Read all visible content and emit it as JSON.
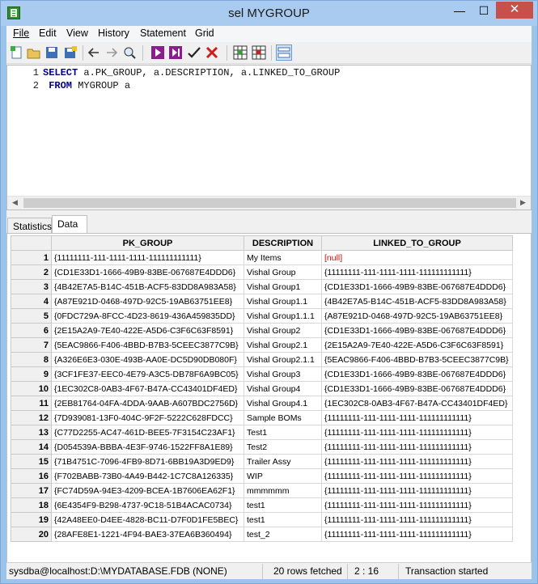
{
  "window": {
    "title": "sel MYGROUP"
  },
  "menu": [
    "File",
    "Edit",
    "View",
    "History",
    "Statement",
    "Grid"
  ],
  "toolbar_icons": [
    "new-icon",
    "open-icon",
    "save-icon",
    "save-as-icon",
    "back-icon",
    "forward-icon",
    "find-icon",
    "execute-icon",
    "execute-step-icon",
    "commit-icon",
    "rollback-icon",
    "grid-view-icon",
    "grid-close-icon",
    "split-view-icon"
  ],
  "editor": {
    "lines": [
      {
        "num": "1",
        "parts": [
          [
            "kw",
            "SELECT"
          ],
          [
            "t",
            " a.PK_GROUP, a.DESCRIPTION, a.LINKED_TO_GROUP"
          ]
        ]
      },
      {
        "num": "2",
        "parts": [
          [
            "t",
            " "
          ],
          [
            "kw",
            "FROM"
          ],
          [
            "t",
            " MYGROUP a"
          ]
        ]
      }
    ]
  },
  "tabs": [
    {
      "label": "Statistics",
      "active": false
    },
    {
      "label": "Data",
      "active": true
    }
  ],
  "grid": {
    "columns": [
      "PK_GROUP",
      "DESCRIPTION",
      "LINKED_TO_GROUP"
    ],
    "rows": [
      [
        "1",
        "{11111111-111-1111-1111-111111111111}",
        "My Items",
        "[null]"
      ],
      [
        "2",
        "{CD1E33D1-1666-49B9-83BE-067687E4DDD6}",
        "Vishal Group",
        "{11111111-111-1111-1111-111111111111}"
      ],
      [
        "3",
        "{4B42E7A5-B14C-451B-ACF5-83DD8A983A58}",
        "Vishal Group1",
        "{CD1E33D1-1666-49B9-83BE-067687E4DDD6}"
      ],
      [
        "4",
        "{A87E921D-0468-497D-92C5-19AB63751EE8}",
        "Vishal Group1.1",
        "{4B42E7A5-B14C-451B-ACF5-83DD8A983A58}"
      ],
      [
        "5",
        "{0FDC729A-8FCC-4D23-8619-436A459835DD}",
        "Vishal Group1.1.1",
        "{A87E921D-0468-497D-92C5-19AB63751EE8}"
      ],
      [
        "6",
        "{2E15A2A9-7E40-422E-A5D6-C3F6C63F8591}",
        "Vishal Group2",
        "{CD1E33D1-1666-49B9-83BE-067687E4DDD6}"
      ],
      [
        "7",
        "{5EAC9866-F406-4BBD-B7B3-5CEEC3877C9B}",
        "Vishal Group2.1",
        "{2E15A2A9-7E40-422E-A5D6-C3F6C63F8591}"
      ],
      [
        "8",
        "{A326E6E3-030E-493B-AA0E-DC5D90DB080F}",
        "Vishal Group2.1.1",
        "{5EAC9866-F406-4BBD-B7B3-5CEEC3877C9B}"
      ],
      [
        "9",
        "{3CF1FE37-EEC0-4E79-A3C5-DB78F6A9BC05}",
        "Vishal Group3",
        "{CD1E33D1-1666-49B9-83BE-067687E4DDD6}"
      ],
      [
        "10",
        "{1EC302C8-0AB3-4F67-B47A-CC43401DF4ED}",
        "Vishal Group4",
        "{CD1E33D1-1666-49B9-83BE-067687E4DDD6}"
      ],
      [
        "11",
        "{2EB81764-04FA-4DDA-9AAB-A607BDC2756D}",
        "Vishal Group4.1",
        "{1EC302C8-0AB3-4F67-B47A-CC43401DF4ED}"
      ],
      [
        "12",
        "{7D939081-13F0-404C-9F2F-5222C628FDCC}",
        "Sample BOMs",
        "{11111111-111-1111-1111-111111111111}"
      ],
      [
        "13",
        "{C77D2255-AC47-461D-BEE5-7F3154C23AF1}",
        "Test1",
        "{11111111-111-1111-1111-111111111111}"
      ],
      [
        "14",
        "{D054539A-BBBA-4E3F-9746-1522FF8A1E89}",
        "Test2",
        "{11111111-111-1111-1111-111111111111}"
      ],
      [
        "15",
        "{71B4751C-7096-4FB9-8D71-6BB19A3D9ED9}",
        "Trailer Assy",
        "{11111111-111-1111-1111-111111111111}"
      ],
      [
        "16",
        "{F702BABB-73B0-4A49-B442-1C7C8A126335}",
        "WIP",
        "{11111111-111-1111-1111-111111111111}"
      ],
      [
        "17",
        "{FC74D59A-94E3-4209-BCEA-1B7606EA62F1}",
        "mmmmmm",
        "{11111111-111-1111-1111-111111111111}"
      ],
      [
        "18",
        "{6E4354F9-B298-4737-9C18-51B4ACAC0734}",
        "test1",
        "{11111111-111-1111-1111-111111111111}"
      ],
      [
        "19",
        "{42A48EE0-D4EE-4828-BC11-D7F0D1FE5BEC}",
        "test1",
        "{11111111-111-1111-1111-111111111111}"
      ],
      [
        "20",
        "{28AFE8E1-1221-4F94-BAE3-37EA6B360494}",
        "test_2",
        "{11111111-111-1111-1111-111111111111}"
      ]
    ]
  },
  "status": {
    "connection": "sysdba@localhost:D:\\MYDATABASE.FDB (NONE)",
    "rows": "20 rows fetched",
    "position": "2 : 16",
    "transaction": "Transaction started"
  }
}
